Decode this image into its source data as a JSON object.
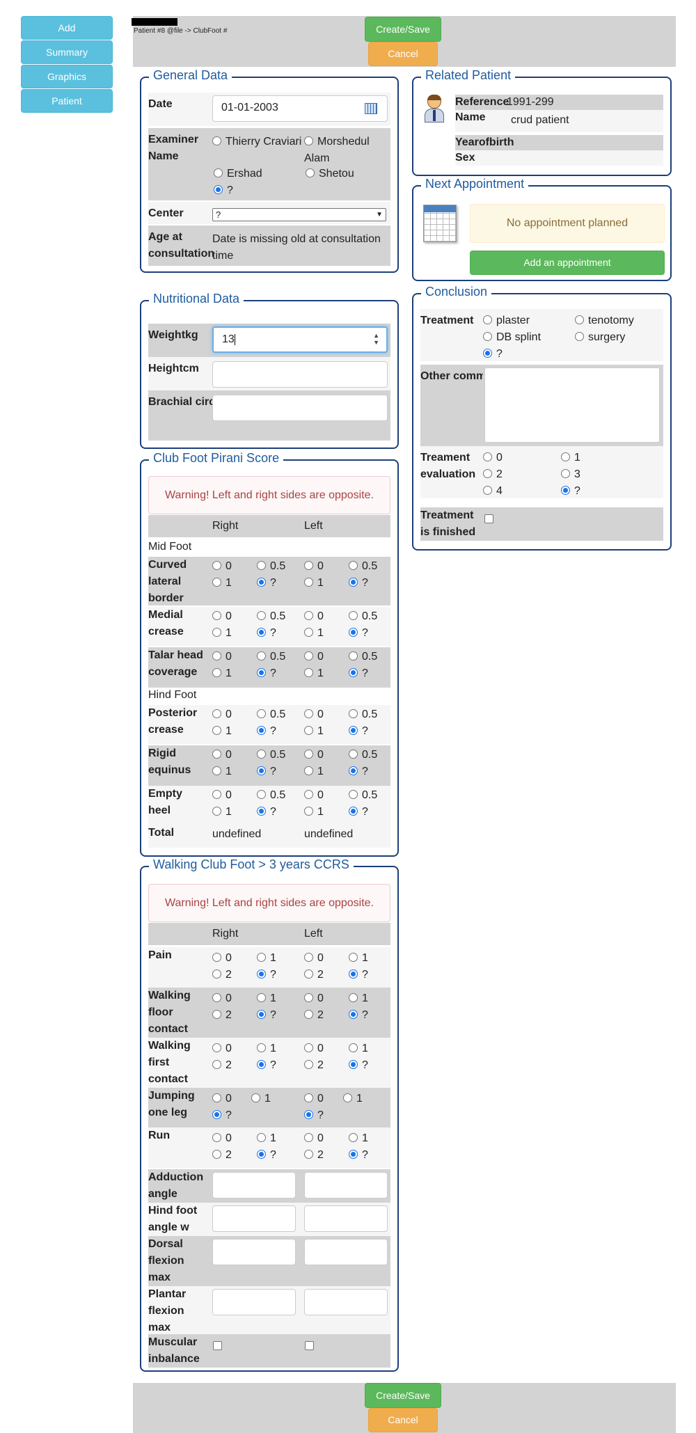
{
  "nav": {
    "add": "Add",
    "summary": "Summary",
    "graphics": "Graphics",
    "patient": "Patient"
  },
  "header": {
    "patient_line": "Patient #8 @file -> ClubFoot #",
    "save": "Create/Save",
    "cancel": "Cancel"
  },
  "general": {
    "title": "General Data",
    "date_label": "Date",
    "date_value": "01-01-2003",
    "examiner_label": "Examiner Name",
    "examiners": [
      "Thierry Craviari",
      "Morshedul Alam",
      "Ershad",
      "Shetou",
      "?"
    ],
    "center_label": "Center",
    "center_value": "?",
    "age_label": "Age at consultation",
    "age_value": "Date is missing old at consultation time"
  },
  "related": {
    "title": "Related Patient",
    "reference_label": "Reference",
    "reference_value": "1991-299",
    "name_label": "Name",
    "name_value": "crud patient",
    "yob_label": "Yearofbirth",
    "yob_value": "",
    "sex_label": "Sex",
    "sex_value": ""
  },
  "appointment": {
    "title": "Next Appointment",
    "none": "No appointment planned",
    "add": "Add an appointment"
  },
  "nutrition": {
    "title": "Nutritional Data",
    "weight_label": "Weightkg",
    "weight_value": "13",
    "height_label": "Heightcm",
    "height_value": "",
    "brachial_label": "Brachial circumference (cm)",
    "brachial_value": ""
  },
  "conclusion": {
    "title": "Conclusion",
    "treatment_label": "Treatment",
    "treatments": [
      "plaster",
      "tenotomy",
      "DB splint",
      "surgery",
      "?"
    ],
    "comments_label": "Other comments/treatments",
    "eval_label": "Treament evaluation",
    "evals": [
      "0",
      "1",
      "2",
      "3",
      "4",
      "?"
    ],
    "finished_label": "Treatment is finished"
  },
  "pirani": {
    "title": "Club Foot Pirani Score",
    "warning": "Warning! Left and right sides are opposite.",
    "right": "Right",
    "left": "Left",
    "midfoot": "Mid Foot",
    "hindfoot": "Hind Foot",
    "options": [
      "0",
      "0.5",
      "1",
      "?"
    ],
    "items": [
      "Curved lateral border",
      "Medial crease",
      "Talar head coverage",
      "Posterior crease",
      "Rigid equinus",
      "Empty heel"
    ],
    "total_label": "Total",
    "total_right": "undefined",
    "total_left": "undefined"
  },
  "ccrs": {
    "title": "Walking Club Foot > 3 years CCRS",
    "warning": "Warning! Left and right sides are opposite.",
    "right": "Right",
    "left": "Left",
    "options": [
      "0",
      "1",
      "2",
      "?"
    ],
    "items": [
      "Pain",
      "Walking floor contact",
      "Walking first contact",
      "Jumping one leg",
      "Run"
    ],
    "fields": [
      "Adduction angle",
      "Hind foot angle w",
      "Dorsal flexion max",
      "Plantar flexion max"
    ],
    "muscular_label": "Muscular inbalance"
  },
  "footer": {
    "save": "Create/Save",
    "cancel": "Cancel"
  },
  "colors": {
    "panel_border": "#1c3f7a",
    "legend": "#1f5b9e",
    "nav_btn": "#5bc0de",
    "save": "#5cb85c",
    "cancel": "#f0ad4e",
    "warn_text": "#a94442",
    "row_dark": "#d3d3d3",
    "row_light": "#f5f5f5"
  }
}
